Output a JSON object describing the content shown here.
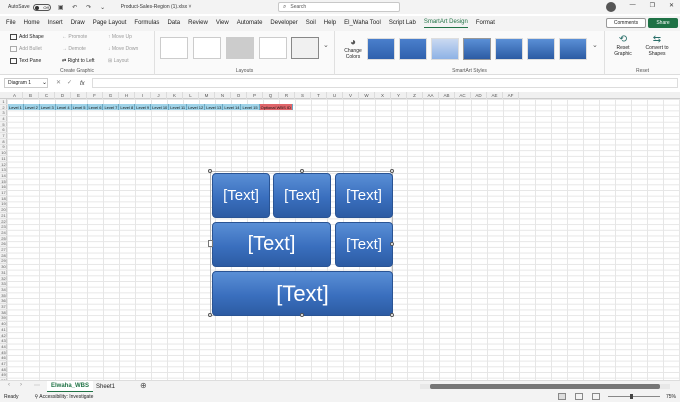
{
  "titlebar": {
    "autosave_label": "AutoSave",
    "autosave_state": "Off",
    "filename": "Product-Sales-Region (1).xlsx",
    "filename_suffix": "˅",
    "search_placeholder": "Search",
    "minimize": "—",
    "restore": "❐",
    "close": "✕"
  },
  "tabs": [
    "File",
    "Home",
    "Insert",
    "Draw",
    "Page Layout",
    "Formulas",
    "Data",
    "Review",
    "View",
    "Automate",
    "Developer",
    "Soil",
    "Help",
    "El_Waha Tool",
    "Script Lab",
    "SmartArt Design",
    "Format"
  ],
  "active_tab": "SmartArt Design",
  "header_buttons": {
    "comments": "Comments",
    "share": "Share"
  },
  "ribbon": {
    "create_graphic": {
      "label": "Create Graphic",
      "add_shape": "Add Shape",
      "add_bullet": "Add Bullet",
      "text_pane": "Text Pane",
      "promote": "Promote",
      "demote": "Demote",
      "right_to_left": "Right to Left",
      "move_up": "Move Up",
      "move_down": "Move Down",
      "layout": "Layout"
    },
    "layouts": {
      "label": "Layouts"
    },
    "smartart_styles": {
      "label": "SmartArt Styles",
      "change_colors": "Change Colors"
    },
    "reset": {
      "label": "Reset",
      "reset_graphic": "Reset Graphic",
      "convert": "Convert to Shapes"
    }
  },
  "formula_bar": {
    "name_box": "Diagram 1",
    "fx": "fx",
    "value": ""
  },
  "columns": [
    "A",
    "B",
    "C",
    "D",
    "E",
    "F",
    "G",
    "H",
    "I",
    "J",
    "K",
    "L",
    "M",
    "N",
    "O",
    "P",
    "Q",
    "R",
    "S",
    "T",
    "U",
    "V",
    "W",
    "X",
    "Y",
    "Z",
    "AA",
    "AB",
    "AC",
    "AD",
    "AE",
    "AF"
  ],
  "rows": [
    "1",
    "2",
    "3",
    "4",
    "5",
    "6",
    "7",
    "8",
    "9",
    "10",
    "11",
    "12",
    "13",
    "14",
    "15",
    "16",
    "17",
    "18",
    "19",
    "20",
    "21",
    "22",
    "23",
    "24",
    "25",
    "26",
    "27",
    "28",
    "29",
    "30",
    "31",
    "32",
    "33",
    "34",
    "35",
    "36",
    "37",
    "38",
    "39",
    "40",
    "41",
    "42",
    "43",
    "44",
    "45",
    "46",
    "47",
    "48",
    "49",
    "50"
  ],
  "level_row": [
    "Level 1",
    "Level 2",
    "Level 3",
    "Level 4",
    "Level 5",
    "Level 6",
    "Level 7",
    "Level 8",
    "Level 9",
    "Level 10",
    "Level 11",
    "Level 12",
    "Level 13",
    "Level 14",
    "Level 15",
    "Optional WBS ID"
  ],
  "smartart": {
    "boxes": [
      "[Text]",
      "[Text]",
      "[Text]",
      "[Text]",
      "[Text]",
      "[Text]"
    ],
    "fill_color": "#3a6fbe"
  },
  "sheets": [
    "Elwaha_WBS",
    "Sheet1"
  ],
  "active_sheet": "Elwaha_WBS",
  "status": {
    "ready": "Ready",
    "accessibility": "Accessibility: Investigate",
    "zoom": "75%"
  },
  "colors": {
    "accent": "#217346",
    "level_fill": "#9fd3e8",
    "optional_fill": "#e0656a"
  }
}
